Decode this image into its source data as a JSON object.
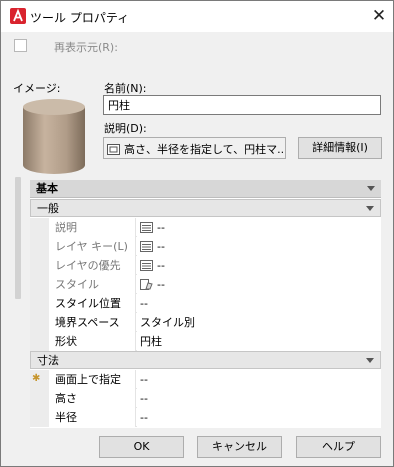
{
  "window": {
    "title": "ツール プロパティ",
    "close_glyph": "✕"
  },
  "redisplay": {
    "label": "再表示元(R):",
    "checked": false
  },
  "image": {
    "label": "イメージ:"
  },
  "name": {
    "label": "名前(N):",
    "value": "円柱"
  },
  "description": {
    "label": "説明(D):",
    "value": "高さ、半径を指定して、円柱マ...",
    "detail_button": "詳細情報(I)"
  },
  "grid": {
    "sections": {
      "basic": "基本",
      "general": "一般",
      "dimensions": "寸法"
    },
    "general_rows": [
      {
        "name": "説明",
        "value": "--",
        "icon": "sheet-icon"
      },
      {
        "name": "レイヤ キー(L)",
        "value": "--",
        "icon": "sheet-icon"
      },
      {
        "name": "レイヤの優先",
        "value": "--",
        "icon": "sheet-icon"
      },
      {
        "name": "スタイル",
        "value": "--",
        "icon": "style-icon"
      },
      {
        "name": "スタイル位置",
        "value": "--"
      },
      {
        "name": "境界スペース",
        "value": "スタイル別"
      },
      {
        "name": "形状",
        "value": "円柱"
      }
    ],
    "dimension_rows": [
      {
        "name": "画面上で指定",
        "value": "--",
        "marker": "✱"
      },
      {
        "name": "高さ",
        "value": "--"
      },
      {
        "name": "半径",
        "value": "--"
      }
    ]
  },
  "buttons": {
    "ok": "OK",
    "cancel": "キャンセル",
    "help": "ヘルプ"
  },
  "colors": {
    "accent_red": "#d9232e",
    "cylinder": "#b39f8c"
  }
}
